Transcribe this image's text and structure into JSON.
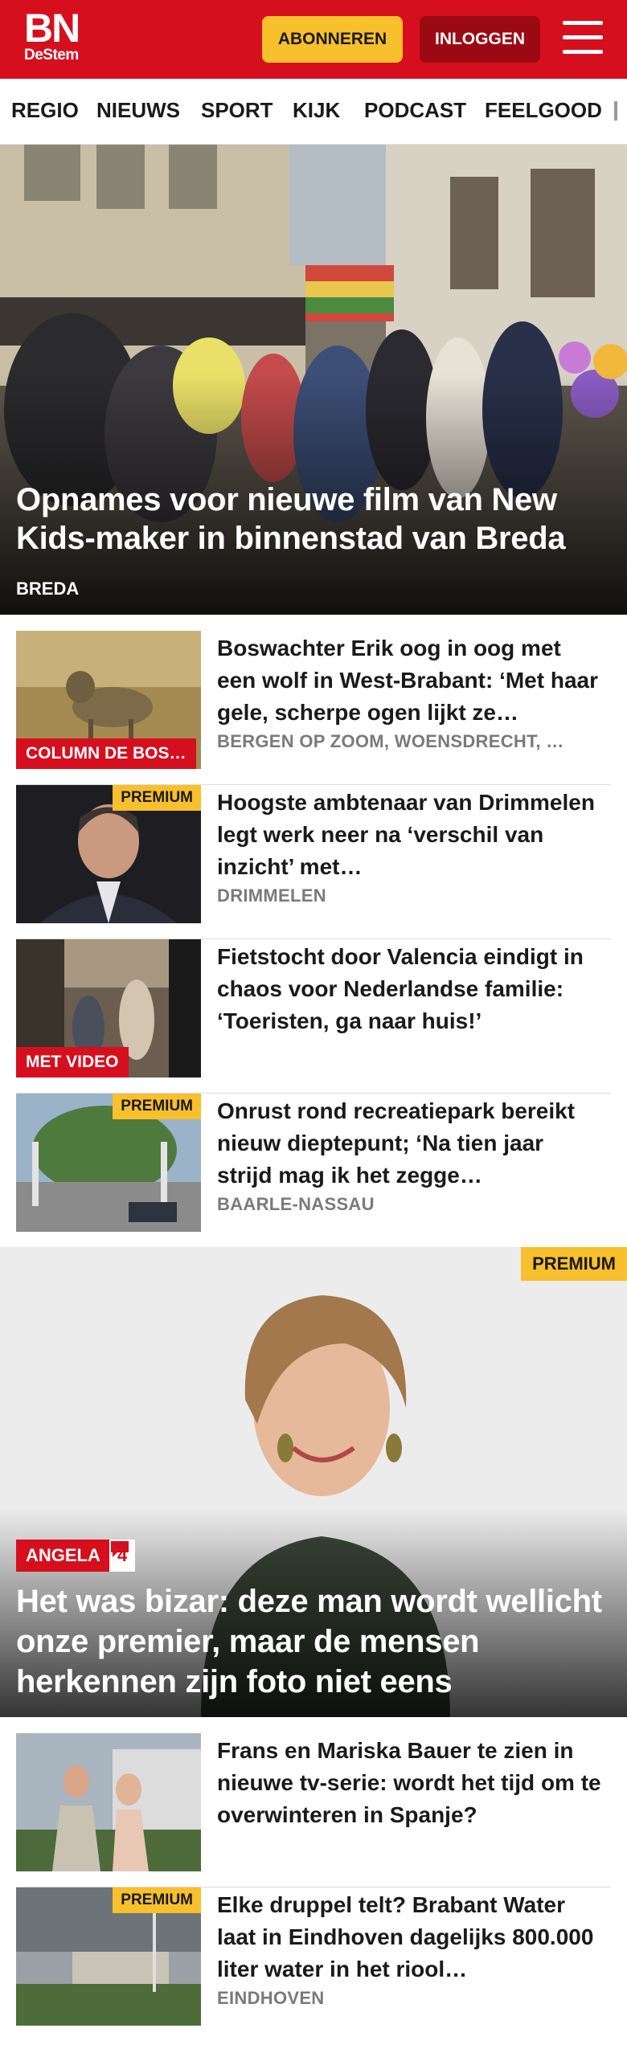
{
  "header": {
    "logo_main": "BN",
    "logo_sub": "DeStem",
    "subscribe_label": "ABONNEREN",
    "login_label": "INLOGGEN",
    "menu_icon": "hamburger-menu-icon",
    "brand_color": "#d50f1e",
    "accent_color": "#f7c02c"
  },
  "nav": {
    "items": [
      "REGIO",
      "NIEUWS",
      "SPORT",
      "KIJK",
      "PODCAST",
      "FEELGOOD"
    ]
  },
  "hero": {
    "title": "Opnames voor nieuwe film van New Kids-maker in binnenstad van Breda",
    "location": "BREDA"
  },
  "articles": [
    {
      "title": "Boswachter Erik oog in oog met een wolf in West-Brabant: ‘Met haar gele, scherpe ogen lijkt ze…",
      "location": "BERGEN OP ZOOM, WOENSDRECHT, …",
      "label": "COLUMN DE BOS…",
      "premium": ""
    },
    {
      "title": "Hoogste ambtenaar van Drimmelen legt werk neer na ‘verschil van inzicht’ met…",
      "location": "DRIMMELEN",
      "label": "",
      "premium": "PREMIUM"
    },
    {
      "title": "Fietstocht door Valencia eindigt in chaos voor Nederlandse familie: ‘Toeristen, ga naar huis!’",
      "location": "",
      "label": "MET VIDEO",
      "premium": ""
    },
    {
      "title": "Onrust rond recreatiepark bereikt nieuw dieptepunt; ‘Na tien jaar strijd mag ik het zegge…",
      "location": "BAARLE-NASSAU",
      "label": "",
      "premium": "PREMIUM"
    }
  ],
  "feature": {
    "premium": "PREMIUM",
    "label": "ANGELA",
    "comment_icon": "comment-bubble-icon",
    "comment_count": "4",
    "title": "Het was bizar: deze man wordt wellicht onze premier, maar de mensen herkennen zijn foto niet eens"
  },
  "articles2": [
    {
      "title": "Frans en Mariska Bauer te zien in nieuwe tv-serie: wordt het tijd om te overwinteren in Spanje?",
      "location": "",
      "premium": ""
    },
    {
      "title": "Elke druppel telt? Brabant Water laat in Eindhoven dagelijks 800.000 liter water in het riool…",
      "location": "EINDHOVEN",
      "premium": "PREMIUM"
    }
  ]
}
